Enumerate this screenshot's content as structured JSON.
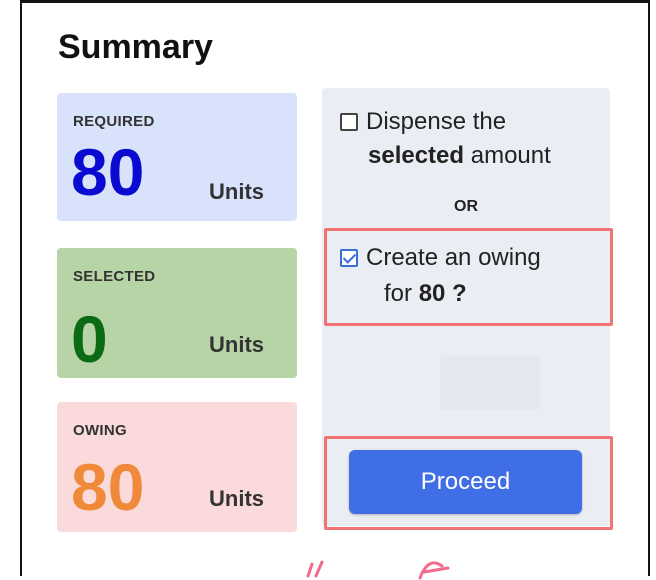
{
  "summary": {
    "title": "Summary",
    "required": {
      "label": "REQUIRED",
      "value": "80",
      "unit": "Units"
    },
    "selected": {
      "label": "SELECTED",
      "value": "0",
      "unit": "Units"
    },
    "owing": {
      "label": "OWING",
      "value": "80",
      "unit": "Units"
    }
  },
  "options": {
    "dispense": {
      "line1": "Dispense the",
      "bold": "selected",
      "rest": " amount",
      "checked": false
    },
    "or": "OR",
    "owing": {
      "line1": "Create an owing",
      "prefix": "for ",
      "bold": "80 ?",
      "checked": true
    }
  },
  "actions": {
    "proceed_label": "Proceed"
  },
  "colors": {
    "required_bg": "#d8e2fb",
    "required_num": "#0a0ad0",
    "selected_bg": "#b7d4a6",
    "selected_num": "#0b6b14",
    "owing_bg": "#fadada",
    "owing_num": "#f08a3a",
    "accent": "#3f6ee6",
    "highlight": "#f27373"
  }
}
